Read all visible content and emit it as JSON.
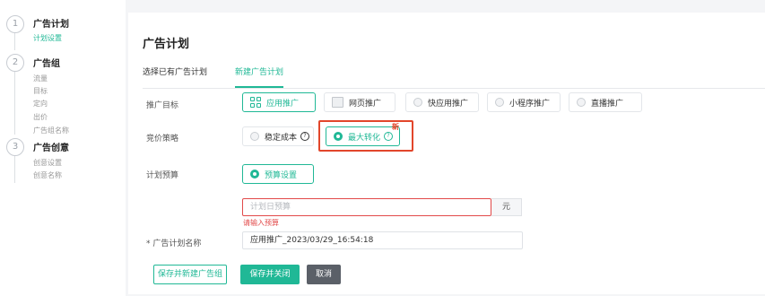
{
  "steps": [
    {
      "num": "1",
      "title": "广告计划",
      "subs": [
        "计划设置"
      ]
    },
    {
      "num": "2",
      "title": "广告组",
      "subs": [
        "流量",
        "目标",
        "定向",
        "出价",
        "广告组名称"
      ]
    },
    {
      "num": "3",
      "title": "广告创意",
      "subs": [
        "创意设置",
        "创意名称"
      ]
    }
  ],
  "page": {
    "title": "广告计划"
  },
  "tabs": [
    {
      "label": "选择已有广告计划",
      "active": false
    },
    {
      "label": "新建广告计划",
      "active": true
    }
  ],
  "promo": {
    "label": "推广目标",
    "options": [
      "应用推广",
      "网页推广",
      "快应用推广",
      "小程序推广",
      "直播推广"
    ],
    "selected": "应用推广"
  },
  "bid": {
    "label": "竞价策略",
    "options": [
      "稳定成本",
      "最大转化"
    ],
    "selected": "最大转化",
    "new_badge": "新"
  },
  "budget": {
    "label": "计划预算",
    "option": "预算设置",
    "placeholder": "计划日预算",
    "unit": "元",
    "error": "请输入预算"
  },
  "plan_name": {
    "label": "* 广告计划名称",
    "value": "应用推广_2023/03/29_16:54:18"
  },
  "buttons": {
    "save_new_group": "保存并新建广告组",
    "save_close": "保存并关闭",
    "cancel": "取消"
  },
  "colors": {
    "accent": "#20b896",
    "highlight": "#e2462b",
    "error": "#e24a4a",
    "cancel": "#5b6068"
  }
}
